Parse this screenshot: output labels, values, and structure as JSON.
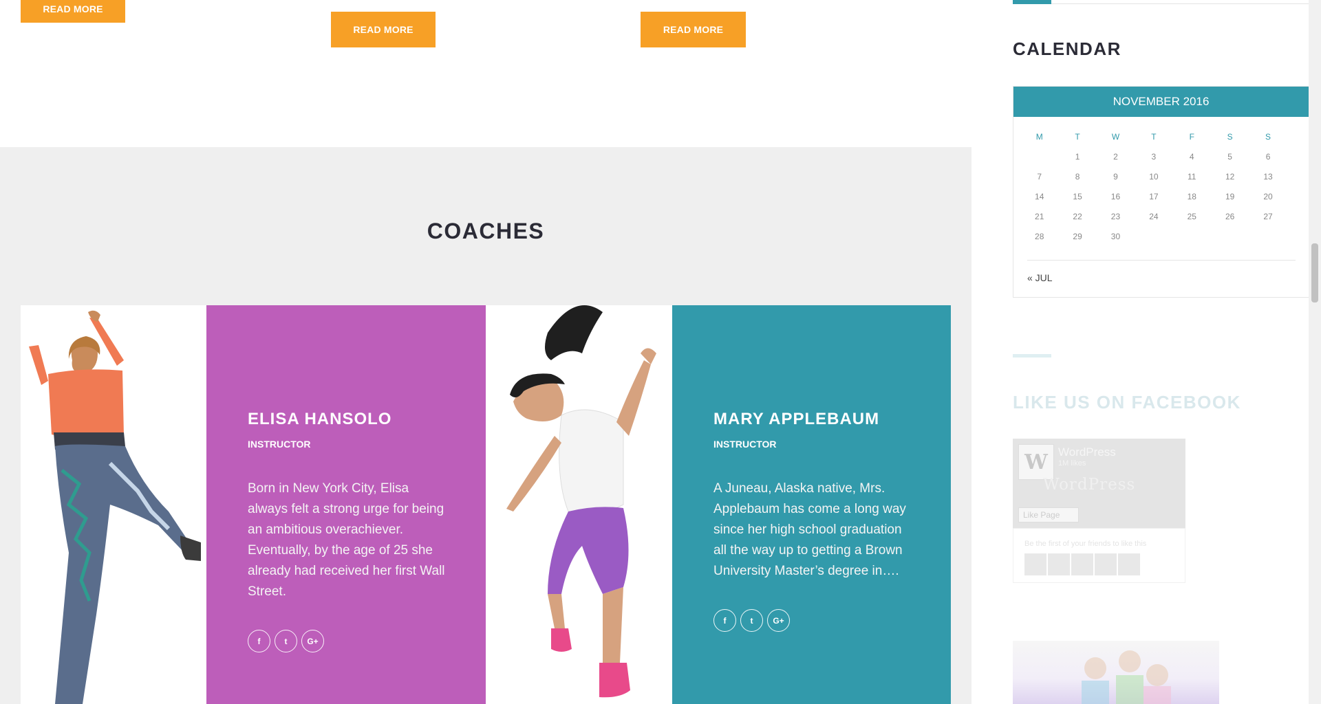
{
  "buttons": {
    "read_more": "READ MORE"
  },
  "coaches": {
    "title": "COACHES",
    "items": [
      {
        "name": "ELISA HANSOLO",
        "role": "INSTRUCTOR",
        "bio": "Born in New York City, Elisa always felt a strong urge for being an ambitious overachiever. Eventually, by the age of 25 she already had received her first Wall Street.",
        "card_color": "#bd5eba",
        "social": [
          {
            "icon": "facebook-icon",
            "glyph": "f"
          },
          {
            "icon": "twitter-icon",
            "glyph": "t"
          },
          {
            "icon": "google-plus-icon",
            "glyph": "G+"
          }
        ]
      },
      {
        "name": "MARY APPLEBAUM",
        "role": "INSTRUCTOR",
        "bio": "A Juneau, Alaska native, Mrs. Applebaum has come a long way since her high school graduation all the way up to getting a Brown University Master’s degree in….",
        "card_color": "#329aab",
        "social": [
          {
            "icon": "facebook-icon",
            "glyph": "f"
          },
          {
            "icon": "twitter-icon",
            "glyph": "t"
          },
          {
            "icon": "google-plus-icon",
            "glyph": "G+"
          }
        ]
      }
    ]
  },
  "sidebar": {
    "calendar": {
      "title": "CALENDAR",
      "month": "NOVEMBER 2016",
      "weekdays": [
        "M",
        "T",
        "W",
        "T",
        "F",
        "S",
        "S"
      ],
      "weeks": [
        [
          "",
          "1",
          "2",
          "3",
          "4",
          "5",
          "6"
        ],
        [
          "7",
          "8",
          "9",
          "10",
          "11",
          "12",
          "13"
        ],
        [
          "14",
          "15",
          "16",
          "17",
          "18",
          "19",
          "20"
        ],
        [
          "21",
          "22",
          "23",
          "24",
          "25",
          "26",
          "27"
        ],
        [
          "28",
          "29",
          "30",
          "",
          "",
          "",
          ""
        ]
      ],
      "prev_link": "« JUL"
    },
    "facebook": {
      "title": "LIKE US ON FACEBOOK",
      "page_name": "WordPress",
      "likes": "1M likes",
      "watermark": "WordPress",
      "like_button": "Like Page",
      "friends_text": "Be the first of your friends to like this"
    }
  },
  "colors": {
    "accent_orange": "#f7a026",
    "teal": "#329aab",
    "purple": "#bd5eba",
    "dark_text": "#2b2b36"
  }
}
